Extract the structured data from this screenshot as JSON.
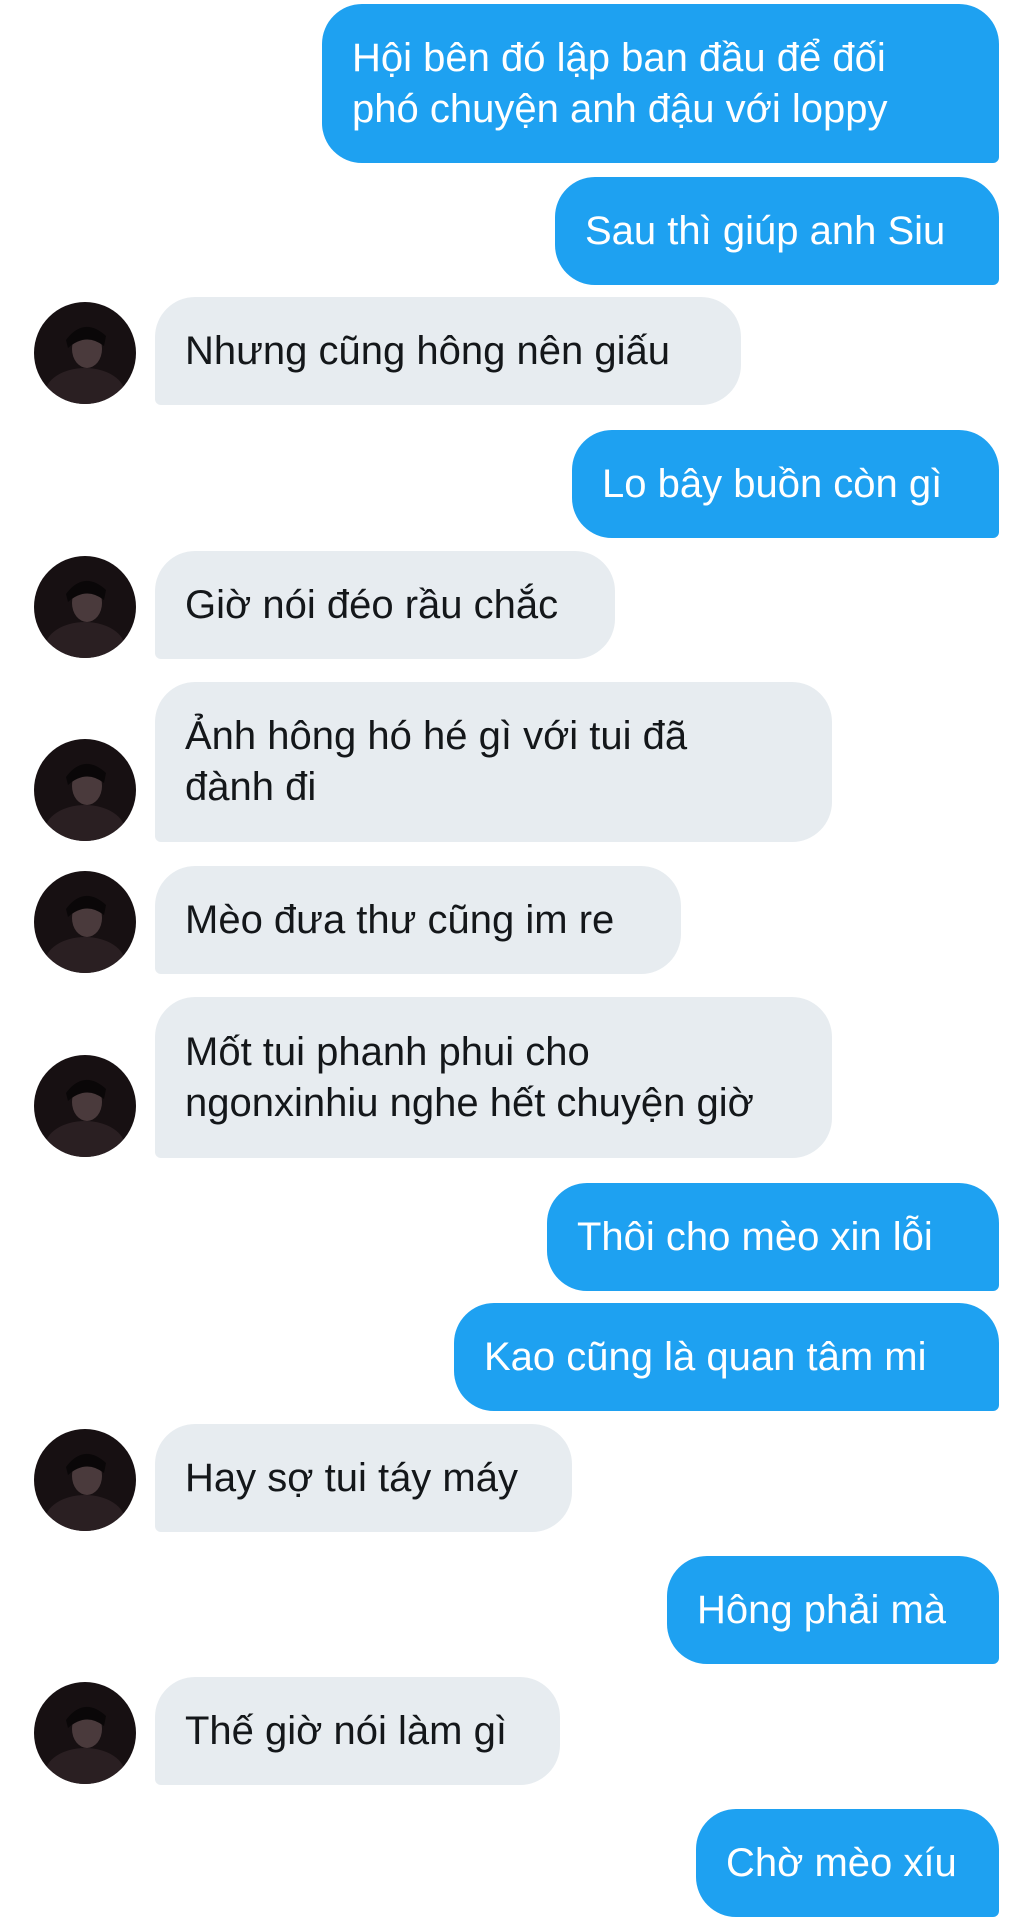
{
  "conversation": {
    "messages": [
      {
        "direction": "sent",
        "text": "Hội bên đó lập ban đầu để đối\nphó chuyện anh đậu với loppy"
      },
      {
        "direction": "sent",
        "text": "Sau thì giúp anh Siu"
      },
      {
        "direction": "received",
        "text": "Nhưng cũng hông nên giấu",
        "avatar": "user-avatar"
      },
      {
        "direction": "sent",
        "text": "Lo bây buồn còn gì"
      },
      {
        "direction": "received",
        "text": "Giờ nói đéo rầu chắc",
        "avatar": "user-avatar"
      },
      {
        "direction": "received",
        "text": "Ảnh hông hó hé gì với tui đã\nđành đi",
        "avatar": "user-avatar"
      },
      {
        "direction": "received",
        "text": "Mèo đưa thư cũng im re",
        "avatar": "user-avatar"
      },
      {
        "direction": "received",
        "text": "Mốt tui phanh phui cho\nngonxinhiu nghe hết chuyện giờ",
        "avatar": "user-avatar"
      },
      {
        "direction": "sent",
        "text": "Thôi cho mèo xin lỗi"
      },
      {
        "direction": "sent",
        "text": "Kao cũng là quan tâm mi"
      },
      {
        "direction": "received",
        "text": "Hay sợ tui táy máy",
        "avatar": "user-avatar"
      },
      {
        "direction": "sent",
        "text": "Hông phải mà"
      },
      {
        "direction": "received",
        "text": "Thế giờ nói làm gì",
        "avatar": "user-avatar"
      },
      {
        "direction": "sent",
        "text": "Chờ mèo xíu"
      }
    ]
  },
  "colors": {
    "sent_bubble": "#1ea1f1",
    "sent_text": "#ffffff",
    "received_bubble": "#e7ecf0",
    "received_text": "#14171a",
    "background": "#ffffff"
  }
}
